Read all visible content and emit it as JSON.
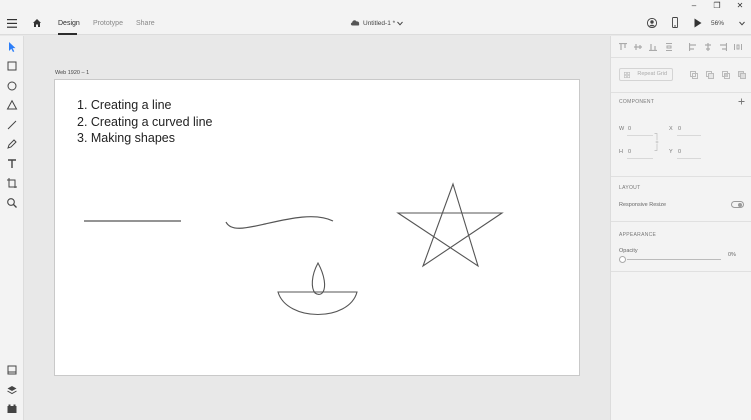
{
  "toolbar": {
    "tabs": [
      {
        "label": "Design",
        "active": true
      },
      {
        "label": "Prototype",
        "active": false
      },
      {
        "label": "Share",
        "active": false
      }
    ],
    "document_title": "Untitled-1 *",
    "zoom": "56%"
  },
  "artboard": {
    "name": "Web 1920 – 1",
    "lines": [
      "1. Creating a line",
      "2. Creating a curved line",
      "3. Making shapes"
    ]
  },
  "inspector": {
    "repeat_grid_label": "Repeat Grid",
    "component_heading": "COMPONENT",
    "fields": {
      "w_label": "W",
      "w_value": "0",
      "x_label": "X",
      "x_value": "0",
      "h_label": "H",
      "h_value": "0",
      "y_label": "Y",
      "y_value": "0"
    },
    "layout_heading": "LAYOUT",
    "responsive_resize_label": "Responsive Resize",
    "appearance_heading": "APPEARANCE",
    "opacity_label": "Opacity",
    "opacity_value": "0%"
  },
  "colors": {
    "chrome": "#f3f3f3",
    "pasteboard": "#e8e8e8",
    "artboard": "#ffffff",
    "stroke": "#555555",
    "active_tool": "#2d7ff9"
  }
}
